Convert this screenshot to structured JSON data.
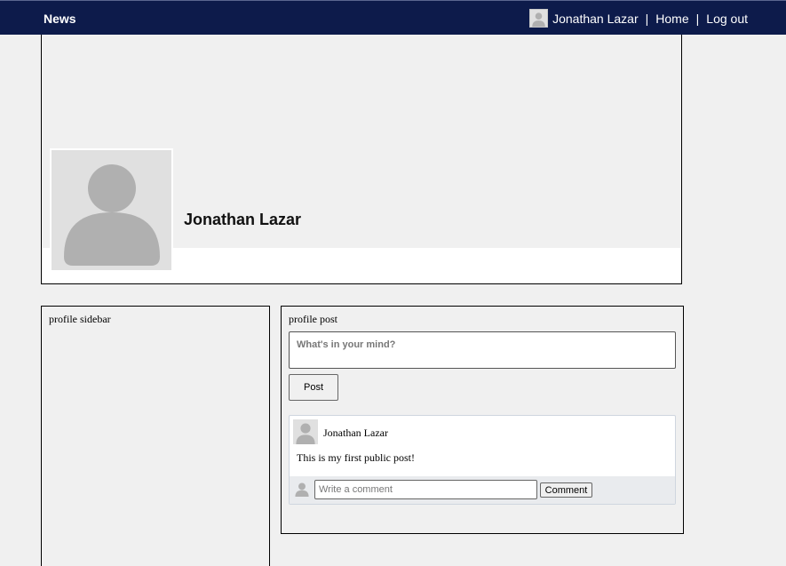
{
  "nav": {
    "brand": "News",
    "user_name": "Jonathan Lazar",
    "separator": "|",
    "home": "Home",
    "logout": "Log out"
  },
  "profile": {
    "name": "Jonathan Lazar"
  },
  "sidebar": {
    "title": "profile sidebar"
  },
  "posts_section": {
    "title": "profile post",
    "composer_placeholder": "What's in your mind?",
    "post_button": "Post"
  },
  "post": {
    "author": "Jonathan Lazar",
    "text": "This is my first public post!",
    "comment_placeholder": "Write a comment",
    "comment_button": "Comment"
  },
  "colors": {
    "navbar": "#0d1b4b",
    "page_bg": "#f0f0f0",
    "avatar_placeholder": "#b0b0b0",
    "comment_bar": "#e9ebee"
  },
  "icons": {
    "avatar": "default-user-silhouette-icon"
  }
}
